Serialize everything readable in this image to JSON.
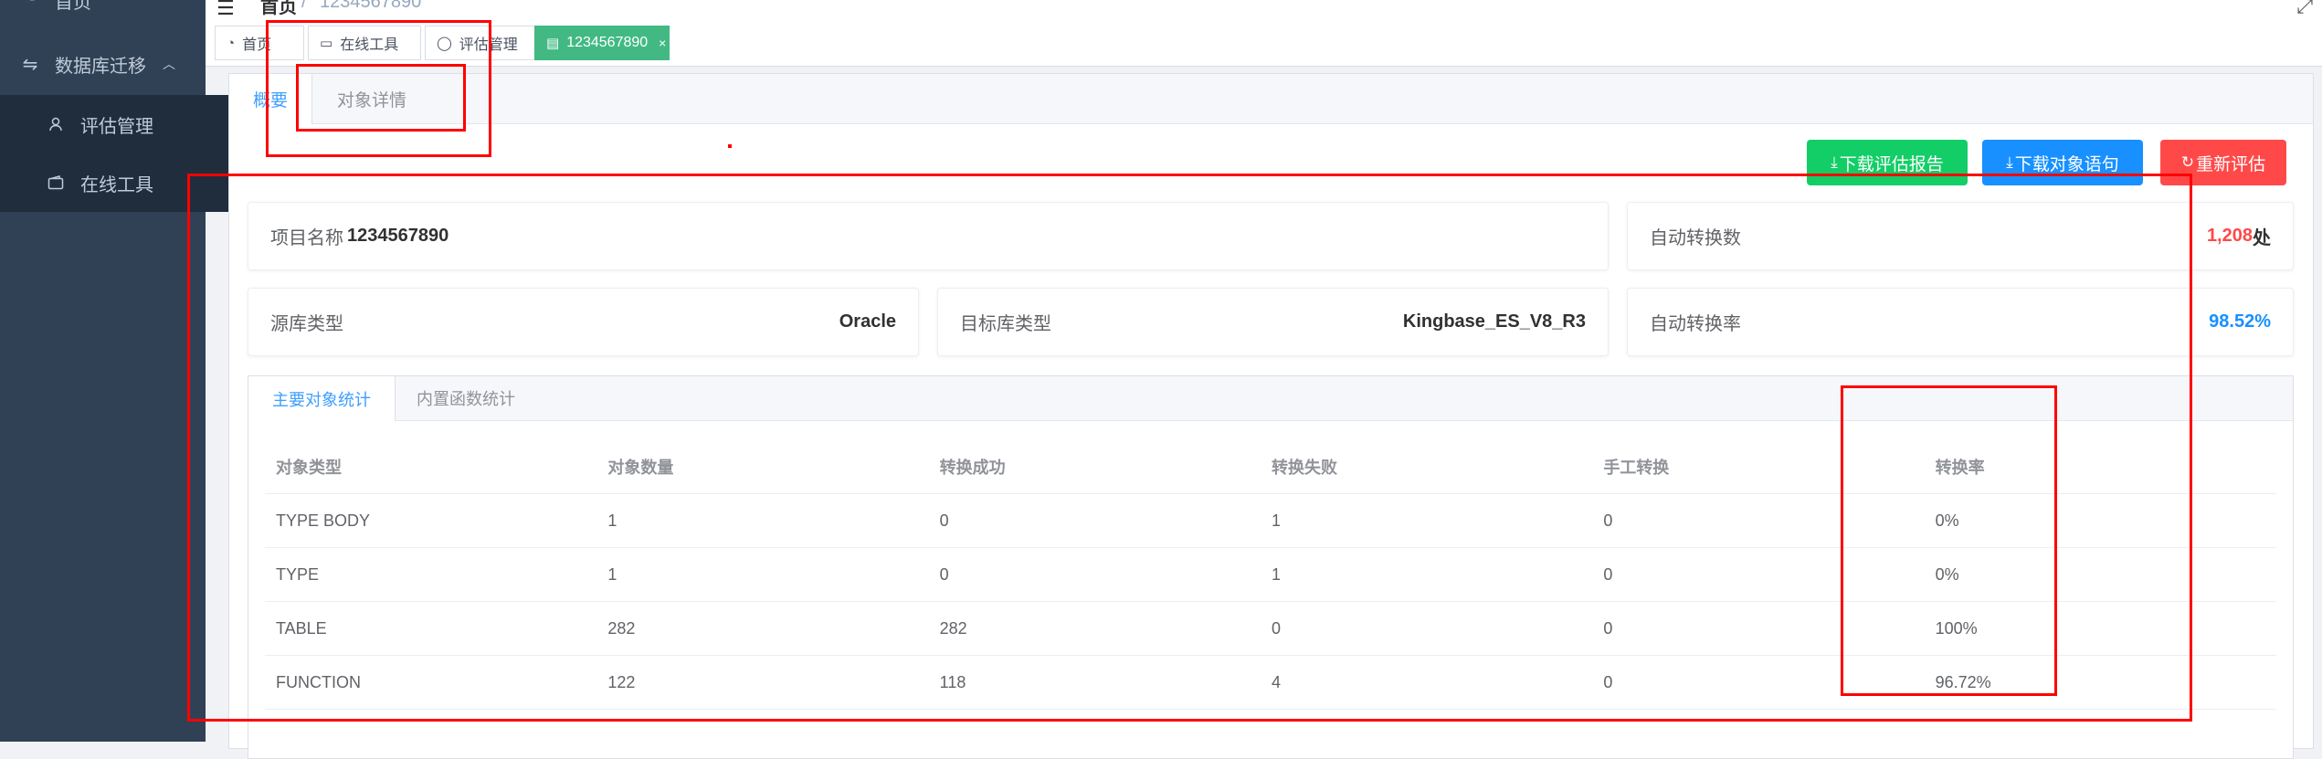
{
  "sidebar": {
    "home": "首页",
    "migrate": "数据库迁移",
    "eval": "评估管理",
    "tools": "在线工具"
  },
  "header": {
    "breadcrumb_home": "首页",
    "breadcrumb_current": "1234567890"
  },
  "tags": {
    "home": "首页",
    "tools": "在线工具",
    "eval": "评估管理",
    "project": "1234567890"
  },
  "page_tabs": [
    "概要",
    "对象详情"
  ],
  "buttons": {
    "download_report": "下载评估报告",
    "download_sql": "下载对象语句",
    "re_eval": "重新评估"
  },
  "info": {
    "project_label": "项目名称",
    "project_value": "1234567890",
    "auto_convert_label": "自动转换数",
    "auto_convert_value": "1,208",
    "auto_convert_unit": "处",
    "source_label": "源库类型",
    "source_value": "Oracle",
    "target_label": "目标库类型",
    "target_value": "Kingbase_ES_V8_R3",
    "rate_label": "自动转换率",
    "rate_value": "98.52%"
  },
  "inner_tabs": [
    "主要对象统计",
    "内置函数统计"
  ],
  "table": {
    "headers": [
      "对象类型",
      "对象数量",
      "转换成功",
      "转换失败",
      "手工转换",
      "转换率"
    ],
    "rows": [
      [
        "TYPE BODY",
        "1",
        "0",
        "1",
        "0",
        "0%"
      ],
      [
        "TYPE",
        "1",
        "0",
        "1",
        "0",
        "0%"
      ],
      [
        "TABLE",
        "282",
        "282",
        "0",
        "0",
        "100%"
      ],
      [
        "FUNCTION",
        "122",
        "118",
        "4",
        "0",
        "96.72%"
      ]
    ]
  },
  "colors": {
    "sidebar_bg": "#304156",
    "active_tag": "#42b983",
    "primary": "#409eff",
    "success": "#67c23a",
    "warning": "#e6a23c",
    "danger": "#ff4949",
    "annotation": "#ff0000"
  }
}
